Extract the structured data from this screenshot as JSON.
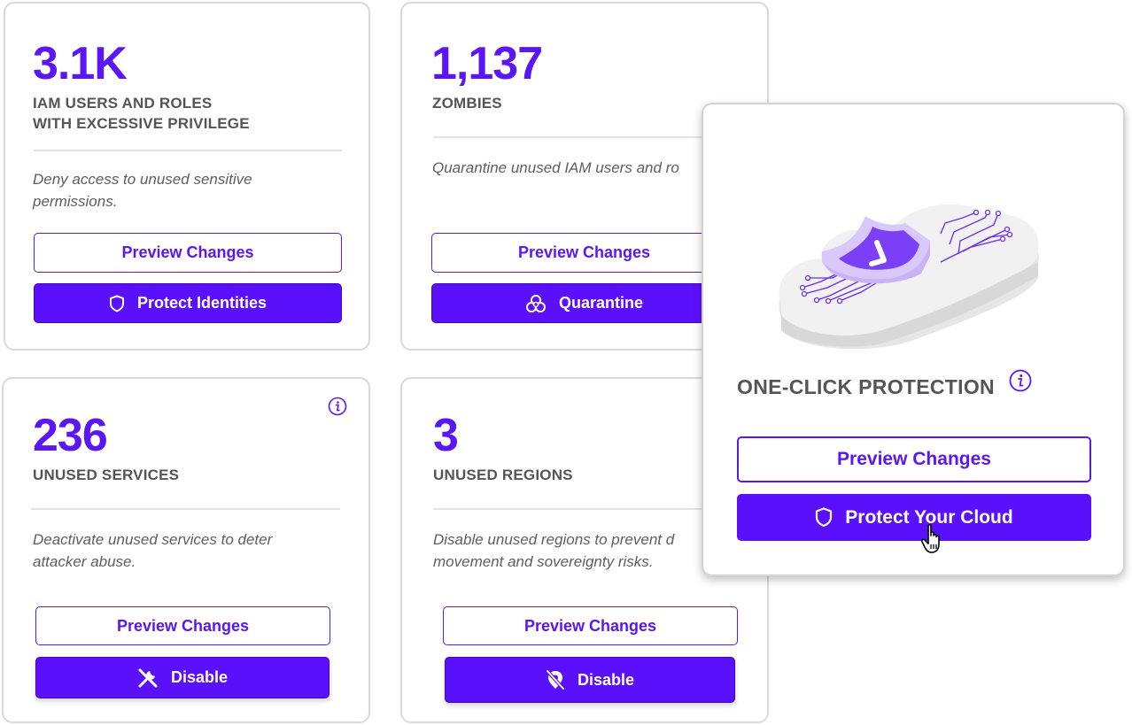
{
  "colors": {
    "accent": "#5b16f6",
    "button_fill": "#5b10fb",
    "label_gray": "#555555",
    "border_gray": "#d9d9d9"
  },
  "cards": [
    {
      "stat": "3.1K",
      "label_line1": "IAM USERS AND ROLES",
      "label_line2": "WITH EXCESSIVE PRIVILEGE",
      "desc_line1": "Deny access to unused sensitive",
      "desc_line2": "permissions.",
      "preview_label": "Preview Changes",
      "action_label": "Protect Identities",
      "action_icon": "shield-icon"
    },
    {
      "stat": "1,137",
      "label_line1": "ZOMBIES",
      "desc_line1": "Quarantine unused IAM users and ro",
      "preview_label": "Preview Changes",
      "action_label": "Quarantine",
      "action_icon": "biohazard-icon"
    },
    {
      "stat": "236",
      "label_line1": "UNUSED SERVICES",
      "desc_line1": "Deactivate unused services to deter",
      "desc_line2": "attacker abuse.",
      "preview_label": "Preview Changes",
      "action_label": "Disable",
      "action_icon": "tools-icon",
      "has_info": true
    },
    {
      "stat": "3",
      "label_line1": "UNUSED REGIONS",
      "desc_line1": "Disable unused regions to prevent d",
      "desc_line2": "movement and sovereignty risks.",
      "preview_label": "Preview Changes",
      "action_label": "Disable",
      "action_icon": "location-off-icon"
    }
  ],
  "overlay": {
    "illustration": "cloud-shield-check-illustration",
    "title": "ONE-CLICK PROTECTION",
    "preview_label": "Preview Changes",
    "action_label": "Protect Your Cloud",
    "action_icon": "shield-icon",
    "cursor": "hand-pointer-cursor"
  }
}
